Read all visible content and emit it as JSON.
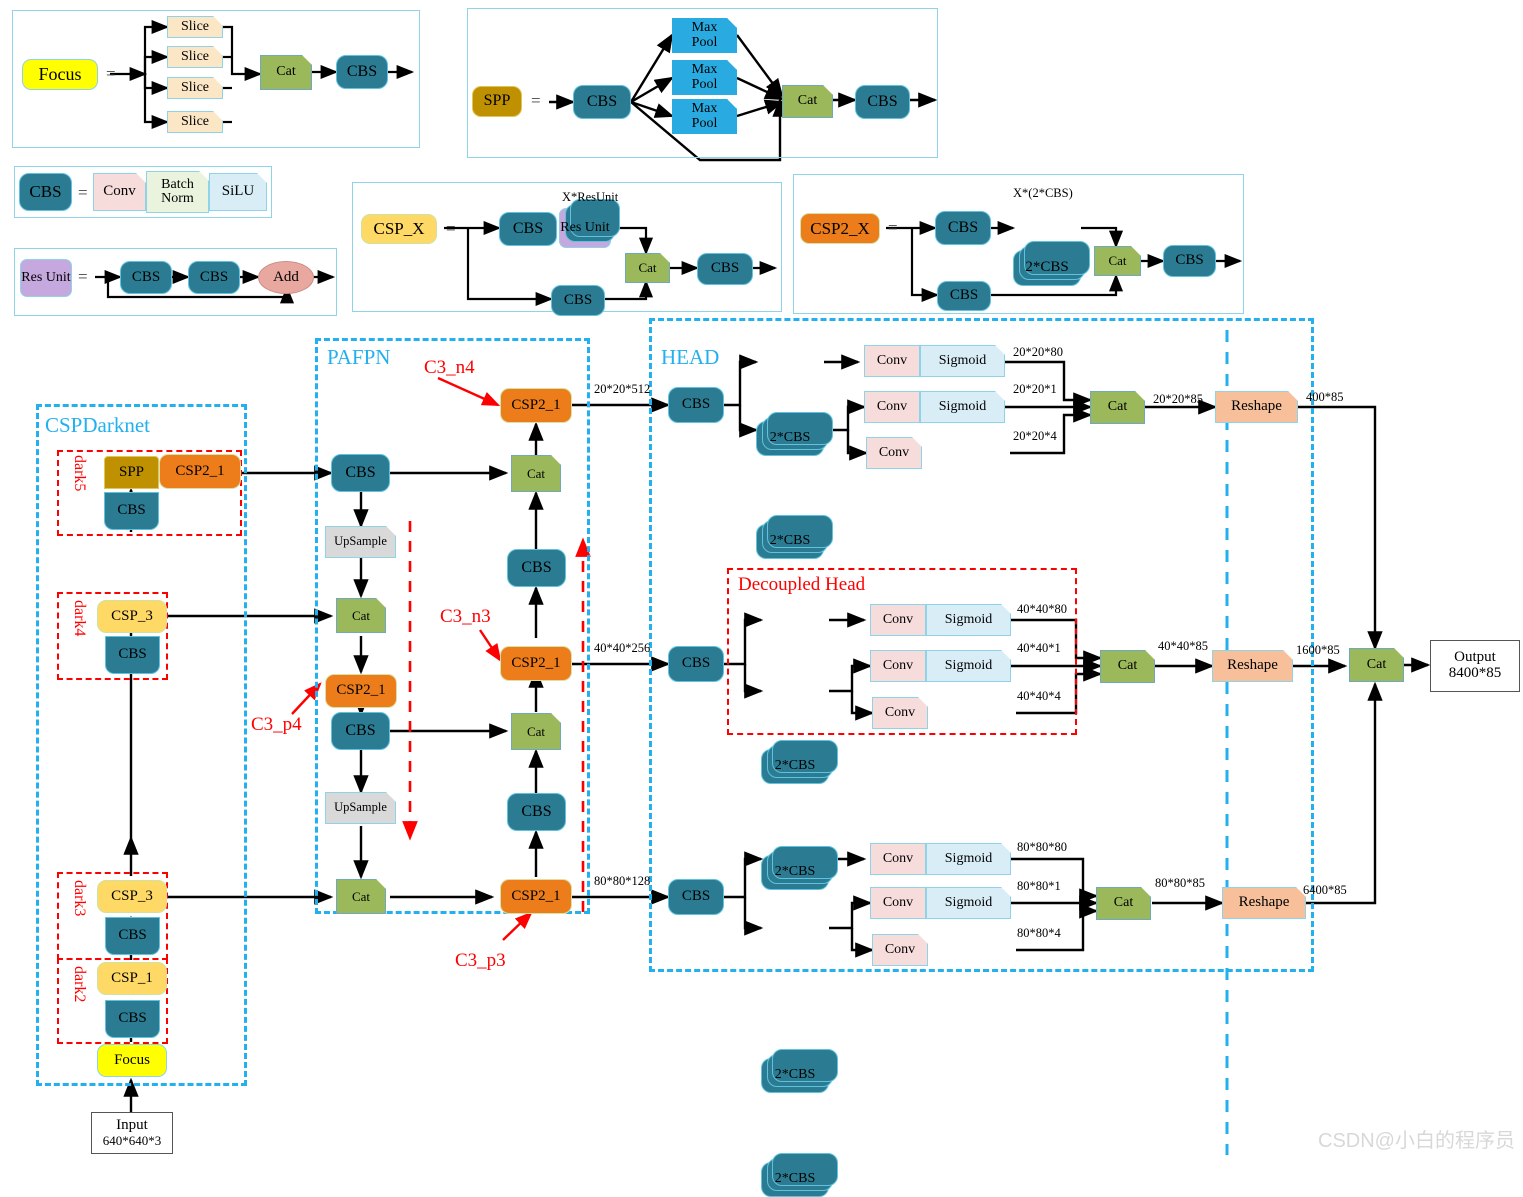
{
  "title": "YOLOX network architecture diagram",
  "legend": {
    "focus": {
      "name": "Focus",
      "eq": "=",
      "slices": [
        "Slice",
        "Slice",
        "Slice",
        "Slice"
      ],
      "cat": "Cat",
      "cbs": "CBS"
    },
    "spp": {
      "name": "SPP",
      "eq": "=",
      "cbs_in": "CBS",
      "maxpools": [
        "Max\nPool",
        "Max\nPool",
        "Max\nPool"
      ],
      "maxpool_label": "Max Pool",
      "cat": "Cat",
      "cbs_out": "CBS"
    },
    "cbs": {
      "name": "CBS",
      "eq": "=",
      "conv": "Conv",
      "batchnorm": "Batch Norm",
      "silu": "SiLU"
    },
    "resunit": {
      "name": "Res Unit",
      "eq": "=",
      "cbs1": "CBS",
      "cbs2": "CBS",
      "add": "Add"
    },
    "csp_x": {
      "name": "CSP_X",
      "eq": "=",
      "cbs_top": "CBS",
      "resunit": "Res Unit",
      "resunit_caption": "X*ResUnit",
      "cbs_bottom": "CBS",
      "cat": "Cat",
      "cbs_out": "CBS"
    },
    "csp2_x": {
      "name": "CSP2_X",
      "eq": "=",
      "cbs_top": "CBS",
      "two_cbs": "2*CBS",
      "two_cbs_caption": "X*(2*CBS)",
      "cbs_bottom": "CBS",
      "cat": "Cat",
      "cbs_out": "CBS"
    }
  },
  "backbone": {
    "title": "CSPDarknet",
    "stage_labels": [
      "dark5",
      "dark4",
      "dark3",
      "dark2"
    ],
    "dark5": {
      "spp": "SPP",
      "csp2_1": "CSP2_1",
      "cbs": "CBS"
    },
    "dark4": {
      "csp_3": "CSP_3",
      "cbs": "CBS"
    },
    "dark3": {
      "csp_3": "CSP_3",
      "cbs": "CBS"
    },
    "dark2": {
      "csp_1": "CSP_1",
      "cbs": "CBS"
    },
    "focus": "Focus",
    "input": {
      "line1": "Input",
      "line2": "640*640*3"
    }
  },
  "pafpn": {
    "title": "PAFPN",
    "cbs_top": "CBS",
    "upsample_1": "UpSample",
    "cat_1": "Cat",
    "csp2_1_p4": "CSP2_1",
    "cbs_mid": "CBS",
    "upsample_2": "UpSample",
    "cat_2": "Cat",
    "csp2_1_p3": "CSP2_1",
    "cbs_n3": "CBS",
    "cat_n3": "Cat",
    "csp2_1_n3": "CSP2_1",
    "cbs_n4": "CBS",
    "cat_n4": "Cat",
    "csp2_1_n4": "CSP2_1",
    "annotations": {
      "c3_n4": "C3_n4",
      "c3_n3": "C3_n3",
      "c3_p4": "C3_p4",
      "c3_p3": "C3_p3"
    }
  },
  "head": {
    "title": "HEAD",
    "decoupled_head_label": "Decoupled Head",
    "branches": [
      {
        "in_dim": "20*20*512",
        "cbs": "CBS",
        "cls_stack": "2*CBS",
        "reg_stack": "2*CBS",
        "cls_conv": "Conv",
        "cls_sigmoid": "Sigmoid",
        "cls_dim": "20*20*80",
        "obj_conv": "Conv",
        "obj_sigmoid": "Sigmoid",
        "obj_dim": "20*20*1",
        "reg_conv": "Conv",
        "reg_dim": "20*20*4",
        "cat": "Cat",
        "cat_dim": "20*20*85",
        "reshape": "Reshape",
        "reshape_dim": "400*85"
      },
      {
        "in_dim": "40*40*256",
        "cbs": "CBS",
        "cls_stack": "2*CBS",
        "reg_stack": "2*CBS",
        "cls_conv": "Conv",
        "cls_sigmoid": "Sigmoid",
        "cls_dim": "40*40*80",
        "obj_conv": "Conv",
        "obj_sigmoid": "Sigmoid",
        "obj_dim": "40*40*1",
        "reg_conv": "Conv",
        "reg_dim": "40*40*4",
        "cat": "Cat",
        "cat_dim": "40*40*85",
        "reshape": "Reshape",
        "reshape_dim": "1600*85"
      },
      {
        "in_dim": "80*80*128",
        "cbs": "CBS",
        "cls_stack": "2*CBS",
        "reg_stack": "2*CBS",
        "cls_conv": "Conv",
        "cls_sigmoid": "Sigmoid",
        "cls_dim": "80*80*80",
        "obj_conv": "Conv",
        "obj_sigmoid": "Sigmoid",
        "obj_dim": "80*80*1",
        "reg_conv": "Conv",
        "reg_dim": "80*80*4",
        "cat": "Cat",
        "cat_dim": "80*80*85",
        "reshape": "Reshape",
        "reshape_dim": "6400*85"
      }
    ],
    "final_cat": "Cat",
    "output": {
      "line1": "Output",
      "line2": "8400*85"
    }
  },
  "watermark": "CSDN@小白的程序员",
  "colors": {
    "teal": "#2b7c92",
    "olive": "#9bb85a",
    "orange": "#ed7d1b",
    "yellow": "#ffff00",
    "light_yellow": "#ffd966",
    "dark_gold": "#bf9000",
    "blue_dash": "#22b0ee",
    "red_dash": "#ff0000",
    "salmon": "#f7c09a",
    "pink": "#f7dcdc",
    "pale_blue": "#d9edf7",
    "purple": "#c5a8dd",
    "gray": "#d9d9d9",
    "maxpool_blue": "#29abe2"
  }
}
